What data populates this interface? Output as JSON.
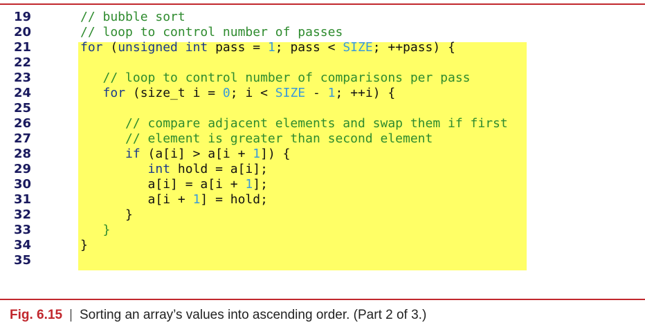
{
  "code_lines": [
    {
      "num": "19",
      "parts": [
        {
          "t": "// bubble sort",
          "c": "cm"
        }
      ]
    },
    {
      "num": "20",
      "parts": [
        {
          "t": "// loop to control number of passes",
          "c": "cm"
        }
      ]
    },
    {
      "num": "21",
      "parts": [
        {
          "t": "for",
          "c": "kw"
        },
        {
          "t": " (",
          "c": "op"
        },
        {
          "t": "unsigned int",
          "c": "kw"
        },
        {
          "t": " pass = ",
          "c": "op"
        },
        {
          "t": "1",
          "c": "nm"
        },
        {
          "t": "; pass < ",
          "c": "op"
        },
        {
          "t": "SIZE",
          "c": "nm"
        },
        {
          "t": "; ++pass) {",
          "c": "op"
        }
      ]
    },
    {
      "num": "22",
      "parts": []
    },
    {
      "num": "23",
      "parts": [
        {
          "t": "   // loop to control number of comparisons per pass",
          "c": "cm"
        }
      ]
    },
    {
      "num": "24",
      "parts": [
        {
          "t": "   ",
          "c": "op"
        },
        {
          "t": "for",
          "c": "kw"
        },
        {
          "t": " (size_t i = ",
          "c": "op"
        },
        {
          "t": "0",
          "c": "nm"
        },
        {
          "t": "; i < ",
          "c": "op"
        },
        {
          "t": "SIZE",
          "c": "nm"
        },
        {
          "t": " - ",
          "c": "op"
        },
        {
          "t": "1",
          "c": "nm"
        },
        {
          "t": "; ++i) {",
          "c": "op"
        }
      ]
    },
    {
      "num": "25",
      "parts": []
    },
    {
      "num": "26",
      "parts": [
        {
          "t": "      // compare adjacent elements and swap them if first",
          "c": "cm"
        }
      ]
    },
    {
      "num": "27",
      "parts": [
        {
          "t": "      // element is greater than second element",
          "c": "cm"
        }
      ]
    },
    {
      "num": "28",
      "parts": [
        {
          "t": "      ",
          "c": "op"
        },
        {
          "t": "if",
          "c": "kw"
        },
        {
          "t": " (a[i] > a[i + ",
          "c": "op"
        },
        {
          "t": "1",
          "c": "nm"
        },
        {
          "t": "]) {",
          "c": "op"
        }
      ]
    },
    {
      "num": "29",
      "parts": [
        {
          "t": "         ",
          "c": "op"
        },
        {
          "t": "int",
          "c": "kw"
        },
        {
          "t": " hold = a[i];",
          "c": "op"
        }
      ]
    },
    {
      "num": "30",
      "parts": [
        {
          "t": "         a[i] = a[i + ",
          "c": "op"
        },
        {
          "t": "1",
          "c": "nm"
        },
        {
          "t": "];",
          "c": "op"
        }
      ]
    },
    {
      "num": "31",
      "parts": [
        {
          "t": "         a[i + ",
          "c": "op"
        },
        {
          "t": "1",
          "c": "nm"
        },
        {
          "t": "] = hold;",
          "c": "op"
        }
      ]
    },
    {
      "num": "32",
      "parts": [
        {
          "t": "      }",
          "c": "op"
        }
      ]
    },
    {
      "num": "33",
      "parts": [
        {
          "t": "   }",
          "c": "cm"
        }
      ]
    },
    {
      "num": "34",
      "parts": [
        {
          "t": "}",
          "c": "op"
        }
      ]
    },
    {
      "num": "35",
      "parts": []
    }
  ],
  "caption": {
    "label": "Fig. 6.15",
    "separator": "|",
    "text": "Sorting an array’s values into ascending order. (Part 2 of 3.)"
  },
  "colors": {
    "rule": "#c1272d",
    "highlight": "#ffff66",
    "keyword": "#1a3a8c",
    "comment": "#2e8b2e",
    "number": "#3a9ad9"
  }
}
